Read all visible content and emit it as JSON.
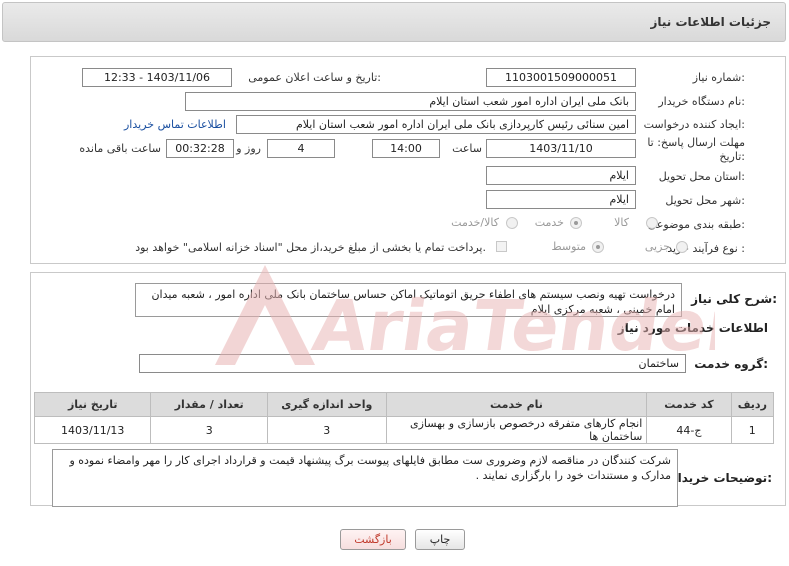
{
  "header": {
    "title": "جزئیات اطلاعات نیاز"
  },
  "form": {
    "need_number": {
      "label": "شماره نیاز:",
      "value": "1103001509000051"
    },
    "announce_datetime": {
      "label": "تاریخ و ساعت اعلان عمومی:",
      "value": "1403/11/06 - 12:33"
    },
    "buyer_org": {
      "label": "نام دستگاه خریدار:",
      "value": "بانک ملی ایران اداره امور شعب استان ایلام"
    },
    "requester": {
      "label": "ایجاد کننده درخواست:",
      "value": "امین سنائی رئیس کارپردازی بانک ملی ایران اداره امور شعب استان ایلام",
      "contact_link": "اطلاعات تماس خریدار"
    },
    "deadline": {
      "label": "مهلت ارسال پاسخ: تا تاریخ:",
      "date": "1403/11/10",
      "time_label": "ساعت",
      "time": "14:00",
      "days": "4",
      "days_label": "روز و",
      "remaining": "00:32:28",
      "remaining_label": "ساعت باقی مانده"
    },
    "delivery_province": {
      "label": "استان محل تحویل:",
      "value": "ایلام"
    },
    "delivery_city": {
      "label": "شهر محل تحویل:",
      "value": "ایلام"
    },
    "category": {
      "label": "طبقه بندی موضوعی:",
      "options": [
        "کالا",
        "خدمت",
        "کالا/خدمت"
      ],
      "selected": "خدمت"
    },
    "process_type": {
      "label": "نوع فرآیند خرید :",
      "options": [
        "جزیی",
        "متوسط"
      ],
      "selected": "متوسط",
      "payment_note": "پرداخت تمام یا بخشی از مبلغ خرید،از محل \"اسناد خزانه اسلامی\" خواهد بود."
    }
  },
  "summary": {
    "label": "شرح کلی نیاز:",
    "text": "درخواست تهیه ونصب سیستم های اطفاء حریق اتوماتیک اماکن حساس ساختمان بانک ملی اداره امور ، شعبه میدان امام خمینی ،  شعبه مرکزی  ایلام"
  },
  "services": {
    "title": "اطلاعات خدمات مورد نیاز",
    "group_label": "گروه خدمت:",
    "group_value": "ساختمان",
    "columns": [
      "ردیف",
      "کد خدمت",
      "نام خدمت",
      "واحد اندازه گیری",
      "تعداد / مقدار",
      "تاریخ نیاز"
    ],
    "rows": [
      {
        "row": "1",
        "code": "ج-44",
        "name": "انجام کارهای متفرقه درخصوص بازسازی و بهسازی ساختمان ها",
        "unit": "3",
        "qty": "3",
        "date": "1403/11/13"
      }
    ]
  },
  "buyer_notes": {
    "label": "توضیحات خریدار:",
    "text": "شرکت کنندگان در مناقصه لازم وضروری ست مطابق فایلهای پیوست برگ پیشنهاد قیمت و قرارداد اجرای کار را مهر وامضاء نموده و مدارک و مستندات خود را بارگزاری نمایند ."
  },
  "buttons": {
    "print": "چاپ",
    "back": "بازگشت"
  },
  "watermark": {
    "text": "AriaTender.net"
  },
  "colors": {
    "link": "#1a4fa0",
    "watermark": "#e8b3b3",
    "header_bg": "#e0e0e0"
  }
}
